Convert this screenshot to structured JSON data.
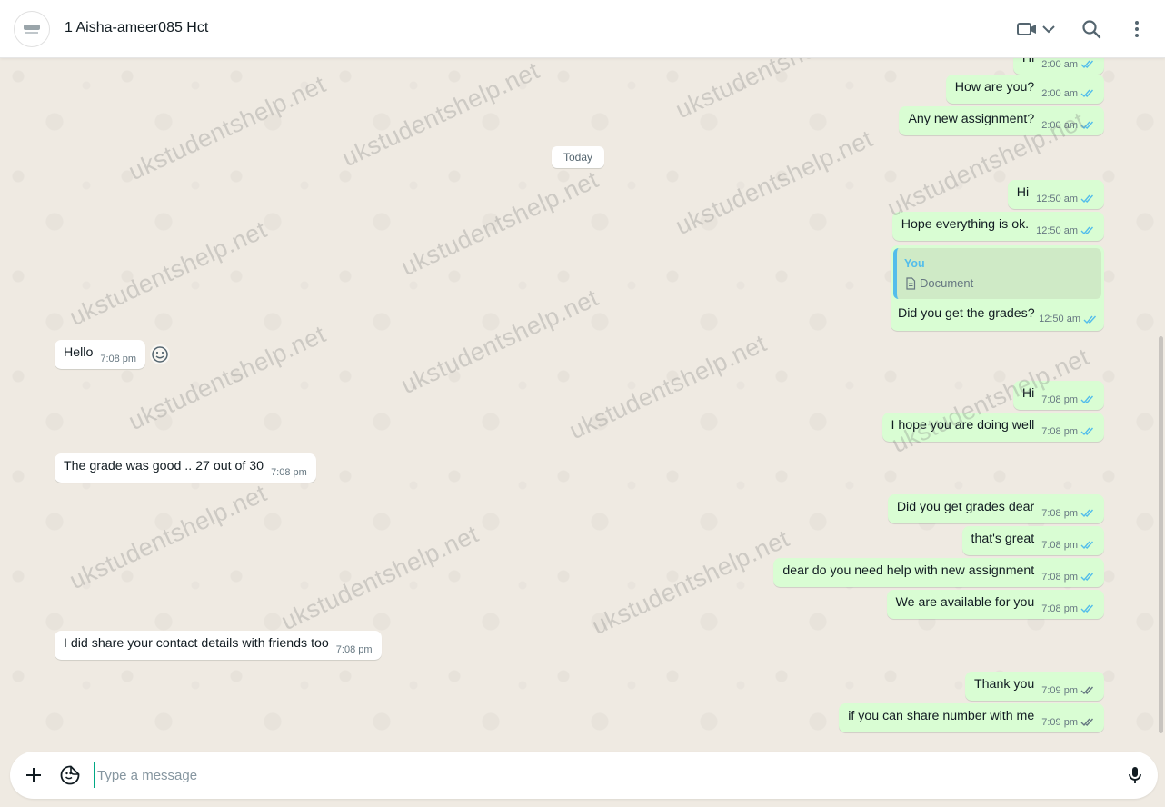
{
  "header": {
    "contact_name": "1 Aisha-ameer085 Hct",
    "icons": [
      "video-call-icon",
      "chevron-down-icon",
      "search-icon",
      "menu-icon"
    ]
  },
  "watermark_text": "ukstudentshelp.net",
  "date_chip": "Today",
  "messages": [
    {
      "dir": "out",
      "text": "Hi",
      "time": "2:00 am",
      "status": "read"
    },
    {
      "dir": "out",
      "text": "How are you?",
      "time": "2:00 am",
      "status": "read"
    },
    {
      "dir": "out",
      "text": "Any new assignment?",
      "time": "2:00 am",
      "status": "read"
    },
    {
      "dir": "out",
      "text": "Hi",
      "time": "12:50 am",
      "status": "read"
    },
    {
      "dir": "out",
      "text": "Hope everything is ok.",
      "time": "12:50 am",
      "status": "read"
    },
    {
      "dir": "out",
      "text": "Did you get the grades?",
      "time": "12:50 am",
      "status": "read",
      "quote": {
        "author": "You",
        "label": "Document"
      }
    },
    {
      "dir": "in",
      "text": "Hello",
      "time": "7:08 pm"
    },
    {
      "dir": "out",
      "text": "Hi",
      "time": "7:08 pm",
      "status": "read"
    },
    {
      "dir": "out",
      "text": "I hope you are doing well",
      "time": "7:08 pm",
      "status": "read"
    },
    {
      "dir": "in",
      "text": "The grade was good .. 27 out of 30",
      "time": "7:08 pm"
    },
    {
      "dir": "out",
      "text": "Did you get grades dear",
      "time": "7:08 pm",
      "status": "read"
    },
    {
      "dir": "out",
      "text": "that's great",
      "time": "7:08 pm",
      "status": "read"
    },
    {
      "dir": "out",
      "text": "dear do you need help with new assignment",
      "time": "7:08 pm",
      "status": "read"
    },
    {
      "dir": "out",
      "text": "We are available for you",
      "time": "7:08 pm",
      "status": "read"
    },
    {
      "dir": "in",
      "text": "I did share your contact details with friends too",
      "time": "7:08 pm"
    },
    {
      "dir": "out",
      "text": "Thank you",
      "time": "7:09 pm",
      "status": "delivered"
    },
    {
      "dir": "out",
      "text": "if you can share number with me",
      "time": "7:09 pm",
      "status": "delivered"
    }
  ],
  "composer": {
    "placeholder": "Type a message"
  },
  "colors": {
    "outgoing_bubble": "#d9fdd3",
    "incoming_bubble": "#ffffff",
    "read_tick": "#53bdeb",
    "delivered_tick": "#667781",
    "chat_background": "#efeae2"
  }
}
